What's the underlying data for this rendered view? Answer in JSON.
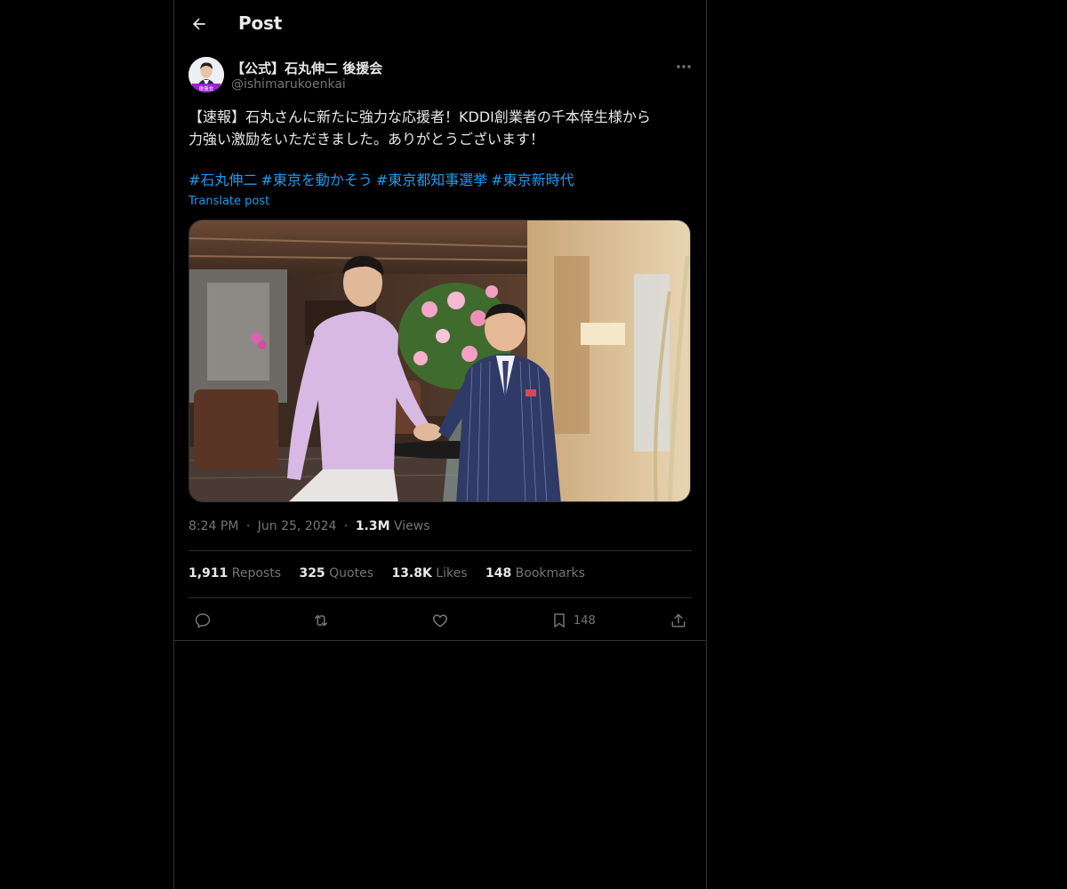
{
  "header": {
    "title": "Post"
  },
  "post": {
    "display_name": "【公式】石丸伸二 後援会",
    "handle": "@ishimarukoenkai",
    "avatar_badge": "後援会",
    "text_lines": [
      "【速報】石丸さんに新たに強力な応援者！KDDI創業者の千本倖生様から",
      "力強い激励をいただきました。ありがとうございます！"
    ],
    "hashtags": [
      "#石丸伸二",
      "#東京を動かそう",
      "#東京都知事選挙",
      "#東京新時代"
    ],
    "translate_label": "Translate post",
    "time": "8:24 PM",
    "date": "Jun 25, 2024",
    "separator": "·",
    "views_count": "1.3M",
    "views_label": "Views"
  },
  "stats": {
    "reposts_count": "1,911",
    "reposts_label": "Reposts",
    "quotes_count": "325",
    "quotes_label": "Quotes",
    "likes_count": "13.8K",
    "likes_label": "Likes",
    "bookmarks_count": "148",
    "bookmarks_label": "Bookmarks"
  },
  "actions": {
    "bookmark_count": "148"
  },
  "icons": {
    "back": "arrow-left-icon",
    "more": "more-horizontal-icon",
    "reply": "reply-icon",
    "repost": "repost-icon",
    "like": "heart-icon",
    "bookmark": "bookmark-icon",
    "share": "share-icon"
  },
  "colors": {
    "background": "#000000",
    "text": "#e7e9ea",
    "muted": "#71767b",
    "accent": "#1d9bf0",
    "border": "#2f3336"
  }
}
